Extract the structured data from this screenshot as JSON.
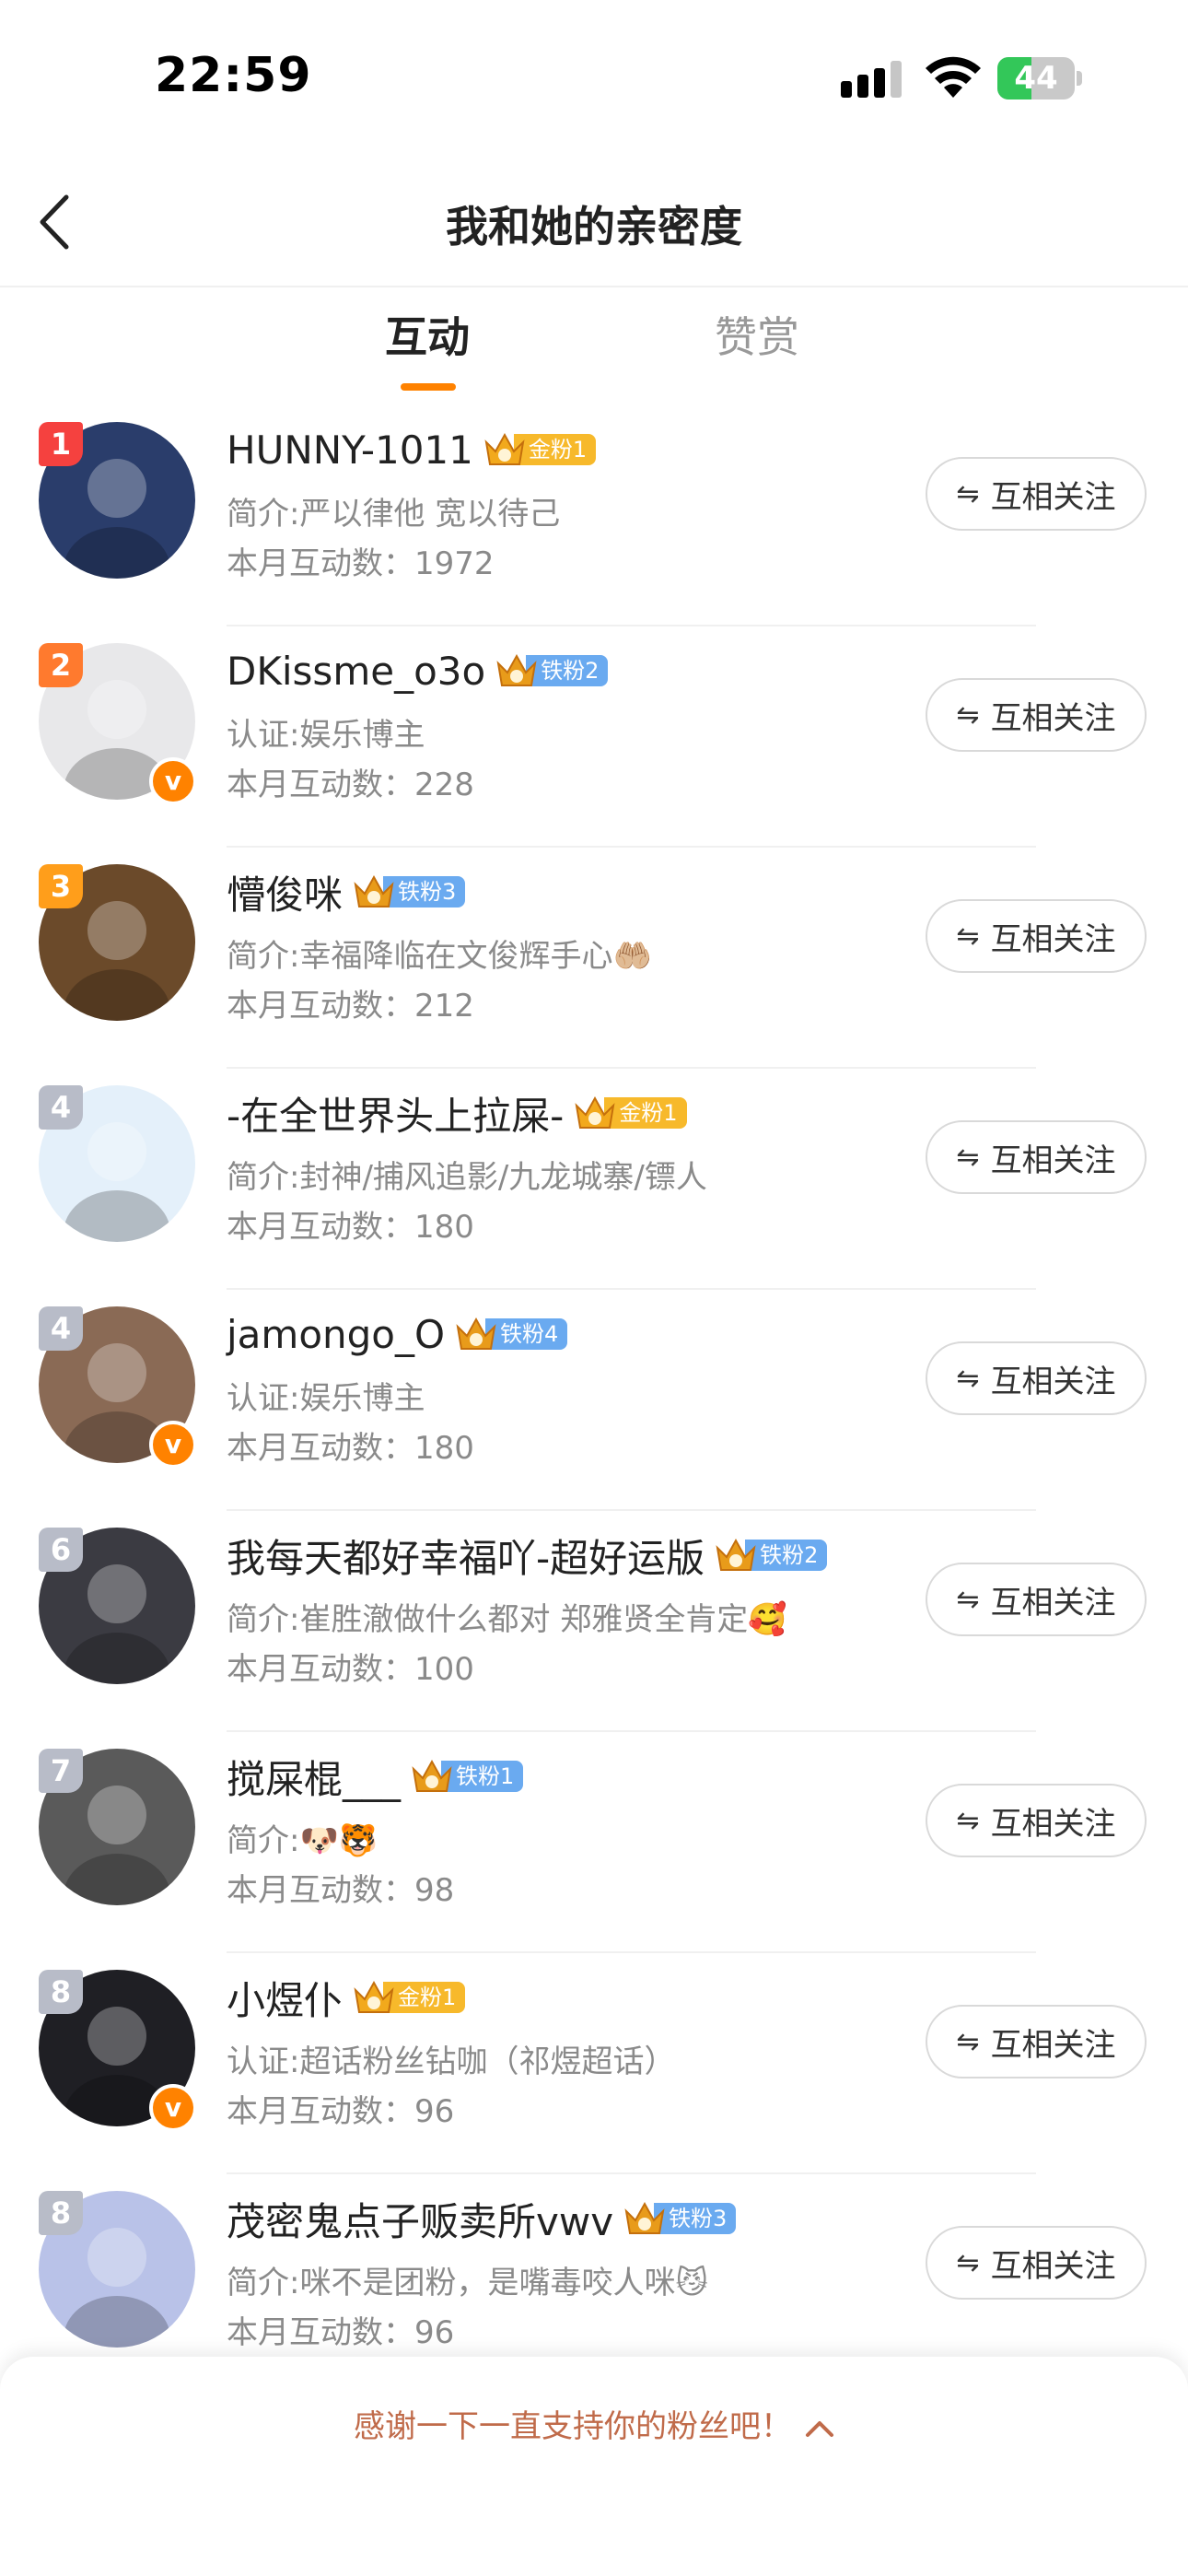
{
  "status_bar": {
    "time": "22:59",
    "battery": "44",
    "battery_level": 0.44
  },
  "header": {
    "title": "我和她的亲密度"
  },
  "tabs": [
    {
      "label": "互动",
      "active": true
    },
    {
      "label": "赞赏",
      "active": false
    }
  ],
  "users": [
    {
      "rank": "1",
      "name": "HUNNY-1011",
      "badge": "金粉1",
      "badge_type": "gold",
      "crown_num": "5",
      "bio": "简介:严以律他 宽以待己",
      "count": "本月互动数：1972",
      "verified": false,
      "follow": "互相关注",
      "rank_color": "#f5413f",
      "avatar_color": "#2a3d6b"
    },
    {
      "rank": "2",
      "name": "DKissme_o3o",
      "badge": "铁粉2",
      "badge_type": "iron",
      "crown_num": "4",
      "bio": "认证:娱乐博主",
      "count": "本月互动数：228",
      "verified": true,
      "follow": "互相关注",
      "rank_color": "#ff7a2e",
      "avatar_color": "#e8e8ea"
    },
    {
      "rank": "3",
      "name": "懵俊咪",
      "badge": "铁粉3",
      "badge_type": "iron",
      "crown_num": "",
      "bio": "简介:幸福降临在文俊辉手心🤲🏼",
      "count": "本月互动数：212",
      "verified": false,
      "follow": "互相关注",
      "rank_color": "#ff9e1b",
      "avatar_color": "#6b4a2a"
    },
    {
      "rank": "4",
      "name": "-在全世界头上拉屎-",
      "badge": "金粉1",
      "badge_type": "gold",
      "crown_num": "3",
      "bio": "简介:封神/捕风追影/九龙城寨/镖人",
      "count": "本月互动数：180",
      "verified": false,
      "follow": "互相关注",
      "rank_color": "#b8bcc8",
      "avatar_color": "#e4f0fa"
    },
    {
      "rank": "4",
      "name": "jamongo_O",
      "badge": "铁粉4",
      "badge_type": "iron",
      "crown_num": "",
      "bio": "认证:娱乐博主",
      "count": "本月互动数：180",
      "verified": true,
      "follow": "互相关注",
      "rank_color": "#b8bcc8",
      "avatar_color": "#8a6a55"
    },
    {
      "rank": "6",
      "name": "我每天都好幸福吖-超好运版",
      "badge": "铁粉2",
      "badge_type": "iron",
      "crown_num": "",
      "bio": "简介:崔胜澈做什么都对 郑雅贤全肯定🥰",
      "count": "本月互动数：100",
      "verified": false,
      "follow": "互相关注",
      "rank_color": "#b8bcc8",
      "avatar_color": "#3b3b42"
    },
    {
      "rank": "7",
      "name": "搅屎棍___",
      "badge": "铁粉1",
      "badge_type": "iron",
      "crown_num": "",
      "bio": "简介:🐶🐯",
      "count": "本月互动数：98",
      "verified": false,
      "follow": "互相关注",
      "rank_color": "#b8bcc8",
      "avatar_color": "#5a5a5a"
    },
    {
      "rank": "8",
      "name": "小煜仆",
      "badge": "金粉1",
      "badge_type": "gold",
      "crown_num": "",
      "bio": "认证:超话粉丝钻咖（祁煜超话）",
      "count": "本月互动数：96",
      "verified": true,
      "follow": "互相关注",
      "rank_color": "#b8bcc8",
      "avatar_color": "#1f1f24"
    },
    {
      "rank": "8",
      "name": "茂密鬼点子贩卖所vwv",
      "badge": "铁粉3",
      "badge_type": "iron",
      "crown_num": "",
      "bio": "简介:咪不是团粉，是嘴毒咬人咪😼",
      "count": "本月互动数：96",
      "verified": false,
      "follow": "互相关注",
      "rank_color": "#b8bcc8",
      "avatar_color": "#b9c2e8"
    }
  ],
  "footer": {
    "thanks_text": "感谢一下一直支持你的粉丝吧！"
  },
  "colors": {
    "accent": "#ff8200",
    "gold_badge": "#f7b92b",
    "iron_badge": "#6aaaf0"
  }
}
